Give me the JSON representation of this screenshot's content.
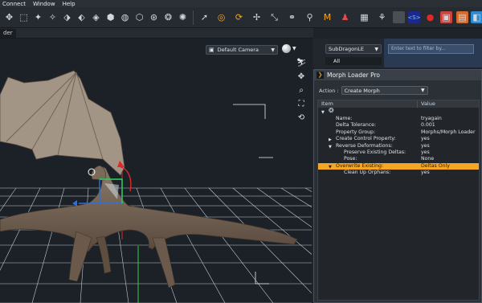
{
  "menu": {
    "items": [
      "Connect",
      "Window",
      "Help"
    ]
  },
  "viewport": {
    "tab_label": "der",
    "camera": "Default Camera"
  },
  "scene": {
    "selected": "SubDragonLE",
    "all_label": "All",
    "filter_placeholder": "Enter text to filter by..."
  },
  "dialog": {
    "title": "Morph Loader Pro",
    "action_label": "Action :",
    "action_value": "Create Morph",
    "col_item": "Item",
    "col_value": "Value",
    "rows": [
      {
        "label": "Name:",
        "value": "tryagain"
      },
      {
        "label": "Delta Tolerance:",
        "value": "0.001"
      },
      {
        "label": "Property Group:",
        "value": "Morphs/Morph Loader"
      },
      {
        "label": "Create Control Property:",
        "value": "yes"
      },
      {
        "label": "Reverse Deformations:",
        "value": "yes"
      },
      {
        "label": "Preserve Existing Deltas:",
        "value": "yes"
      },
      {
        "label": "Pose:",
        "value": "None"
      },
      {
        "label": "Overwrite Existing:",
        "value": "Deltas Only"
      },
      {
        "label": "Clean Up Orphans:",
        "value": "yes"
      }
    ]
  },
  "colors": {
    "accent": "#f5a623",
    "panel": "#2b3036",
    "viewport": "#1c2127",
    "filter": "#3b4f6c"
  }
}
